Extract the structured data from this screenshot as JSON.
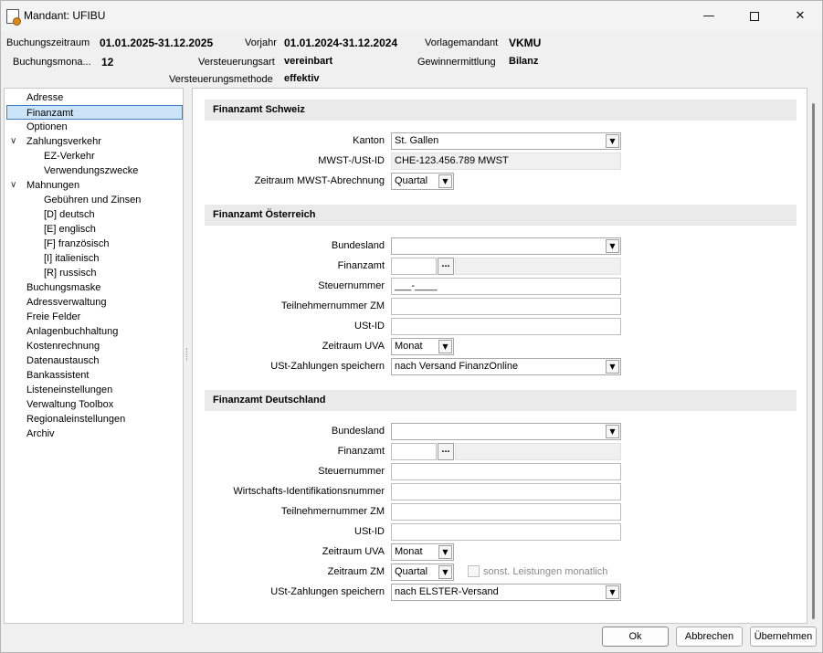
{
  "window": {
    "title": "Mandant: UFIBU",
    "minimize": "—",
    "close": "✕"
  },
  "header": {
    "buchungszeitraum_label": "Buchungszeitraum",
    "buchungszeitraum_value": "01.01.2025-31.12.2025",
    "vorjahr_label": "Vorjahr",
    "vorjahr_value": "01.01.2024-31.12.2024",
    "vorlagemandant_label": "Vorlagemandant",
    "vorlagemandant_value": "VKMU",
    "buchungsmonat_label": "Buchungsmona...",
    "buchungsmonat_value": "12",
    "versteuerungsart_label": "Versteuerungsart",
    "versteuerungsart_value": "vereinbart",
    "gewinnermittlung_label": "Gewinnermittlung",
    "gewinnermittlung_value": "Bilanz",
    "versteuerungsmethode_label": "Versteuerungsmethode",
    "versteuerungsmethode_value": "effektiv"
  },
  "tree": {
    "items": [
      {
        "label": "Adresse"
      },
      {
        "label": "Finanzamt",
        "selected": true
      },
      {
        "label": "Optionen"
      },
      {
        "label": "Zahlungsverkehr",
        "expanded": true
      },
      {
        "label": "EZ-Verkehr"
      },
      {
        "label": "Verwendungszwecke"
      },
      {
        "label": "Mahnungen",
        "expanded": true
      },
      {
        "label": "Gebühren und Zinsen"
      },
      {
        "label": "[D]  deutsch"
      },
      {
        "label": "[E]  englisch"
      },
      {
        "label": "[F]  französisch"
      },
      {
        "label": "[I]  italienisch"
      },
      {
        "label": "[R]  russisch"
      },
      {
        "label": "Buchungsmaske"
      },
      {
        "label": "Adressverwaltung"
      },
      {
        "label": "Freie Felder"
      },
      {
        "label": "Anlagenbuchhaltung"
      },
      {
        "label": "Kostenrechnung"
      },
      {
        "label": "Datenaustausch"
      },
      {
        "label": "Bankassistent"
      },
      {
        "label": "Listeneinstellungen"
      },
      {
        "label": "Verwaltung Toolbox"
      },
      {
        "label": "Regionaleinstellungen"
      },
      {
        "label": "Archiv"
      }
    ],
    "chevron": "∨"
  },
  "schweiz": {
    "title": "Finanzamt Schweiz",
    "kanton_label": "Kanton",
    "kanton_value": "St. Gallen",
    "mwst_label": "MWST-/USt-ID",
    "mwst_value": "CHE-123.456.789 MWST",
    "zeitraum_label": "Zeitraum MWST-Abrechnung",
    "zeitraum_value": "Quartal"
  },
  "oesterreich": {
    "title": "Finanzamt Österreich",
    "bundesland_label": "Bundesland",
    "bundesland_value": "",
    "finanzamt_label": "Finanzamt",
    "finanzamt_value": "",
    "steuernummer_label": "Steuernummer",
    "steuernummer_value": "___-____",
    "teilnehmer_label": "Teilnehmernummer ZM",
    "teilnehmer_value": "",
    "ustid_label": "USt-ID",
    "ustid_value": "",
    "zeitraum_uva_label": "Zeitraum UVA",
    "zeitraum_uva_value": "Monat",
    "zahlungen_label": "USt-Zahlungen speichern",
    "zahlungen_value": "nach Versand FinanzOnline"
  },
  "deutschland": {
    "title": "Finanzamt Deutschland",
    "bundesland_label": "Bundesland",
    "bundesland_value": "",
    "finanzamt_label": "Finanzamt",
    "finanzamt_value": "",
    "steuernummer_label": "Steuernummer",
    "steuernummer_value": "",
    "wid_label": "Wirtschafts-Identifikationsnummer",
    "wid_value": "",
    "teilnehmer_label": "Teilnehmernummer ZM",
    "teilnehmer_value": "",
    "ustid_label": "USt-ID",
    "ustid_value": "",
    "zeitraum_uva_label": "Zeitraum UVA",
    "zeitraum_uva_value": "Monat",
    "zeitraum_zm_label": "Zeitraum ZM",
    "zeitraum_zm_value": "Quartal",
    "sonst_label": "sonst. Leistungen monatlich",
    "sonst_checked": false,
    "zahlungen_label": "USt-Zahlungen speichern",
    "zahlungen_value": "nach ELSTER-Versand"
  },
  "combo_arrow": "▼",
  "dots": "...",
  "buttons": {
    "ok": "Ok",
    "cancel": "Abbrechen",
    "apply": "Übernehmen"
  }
}
